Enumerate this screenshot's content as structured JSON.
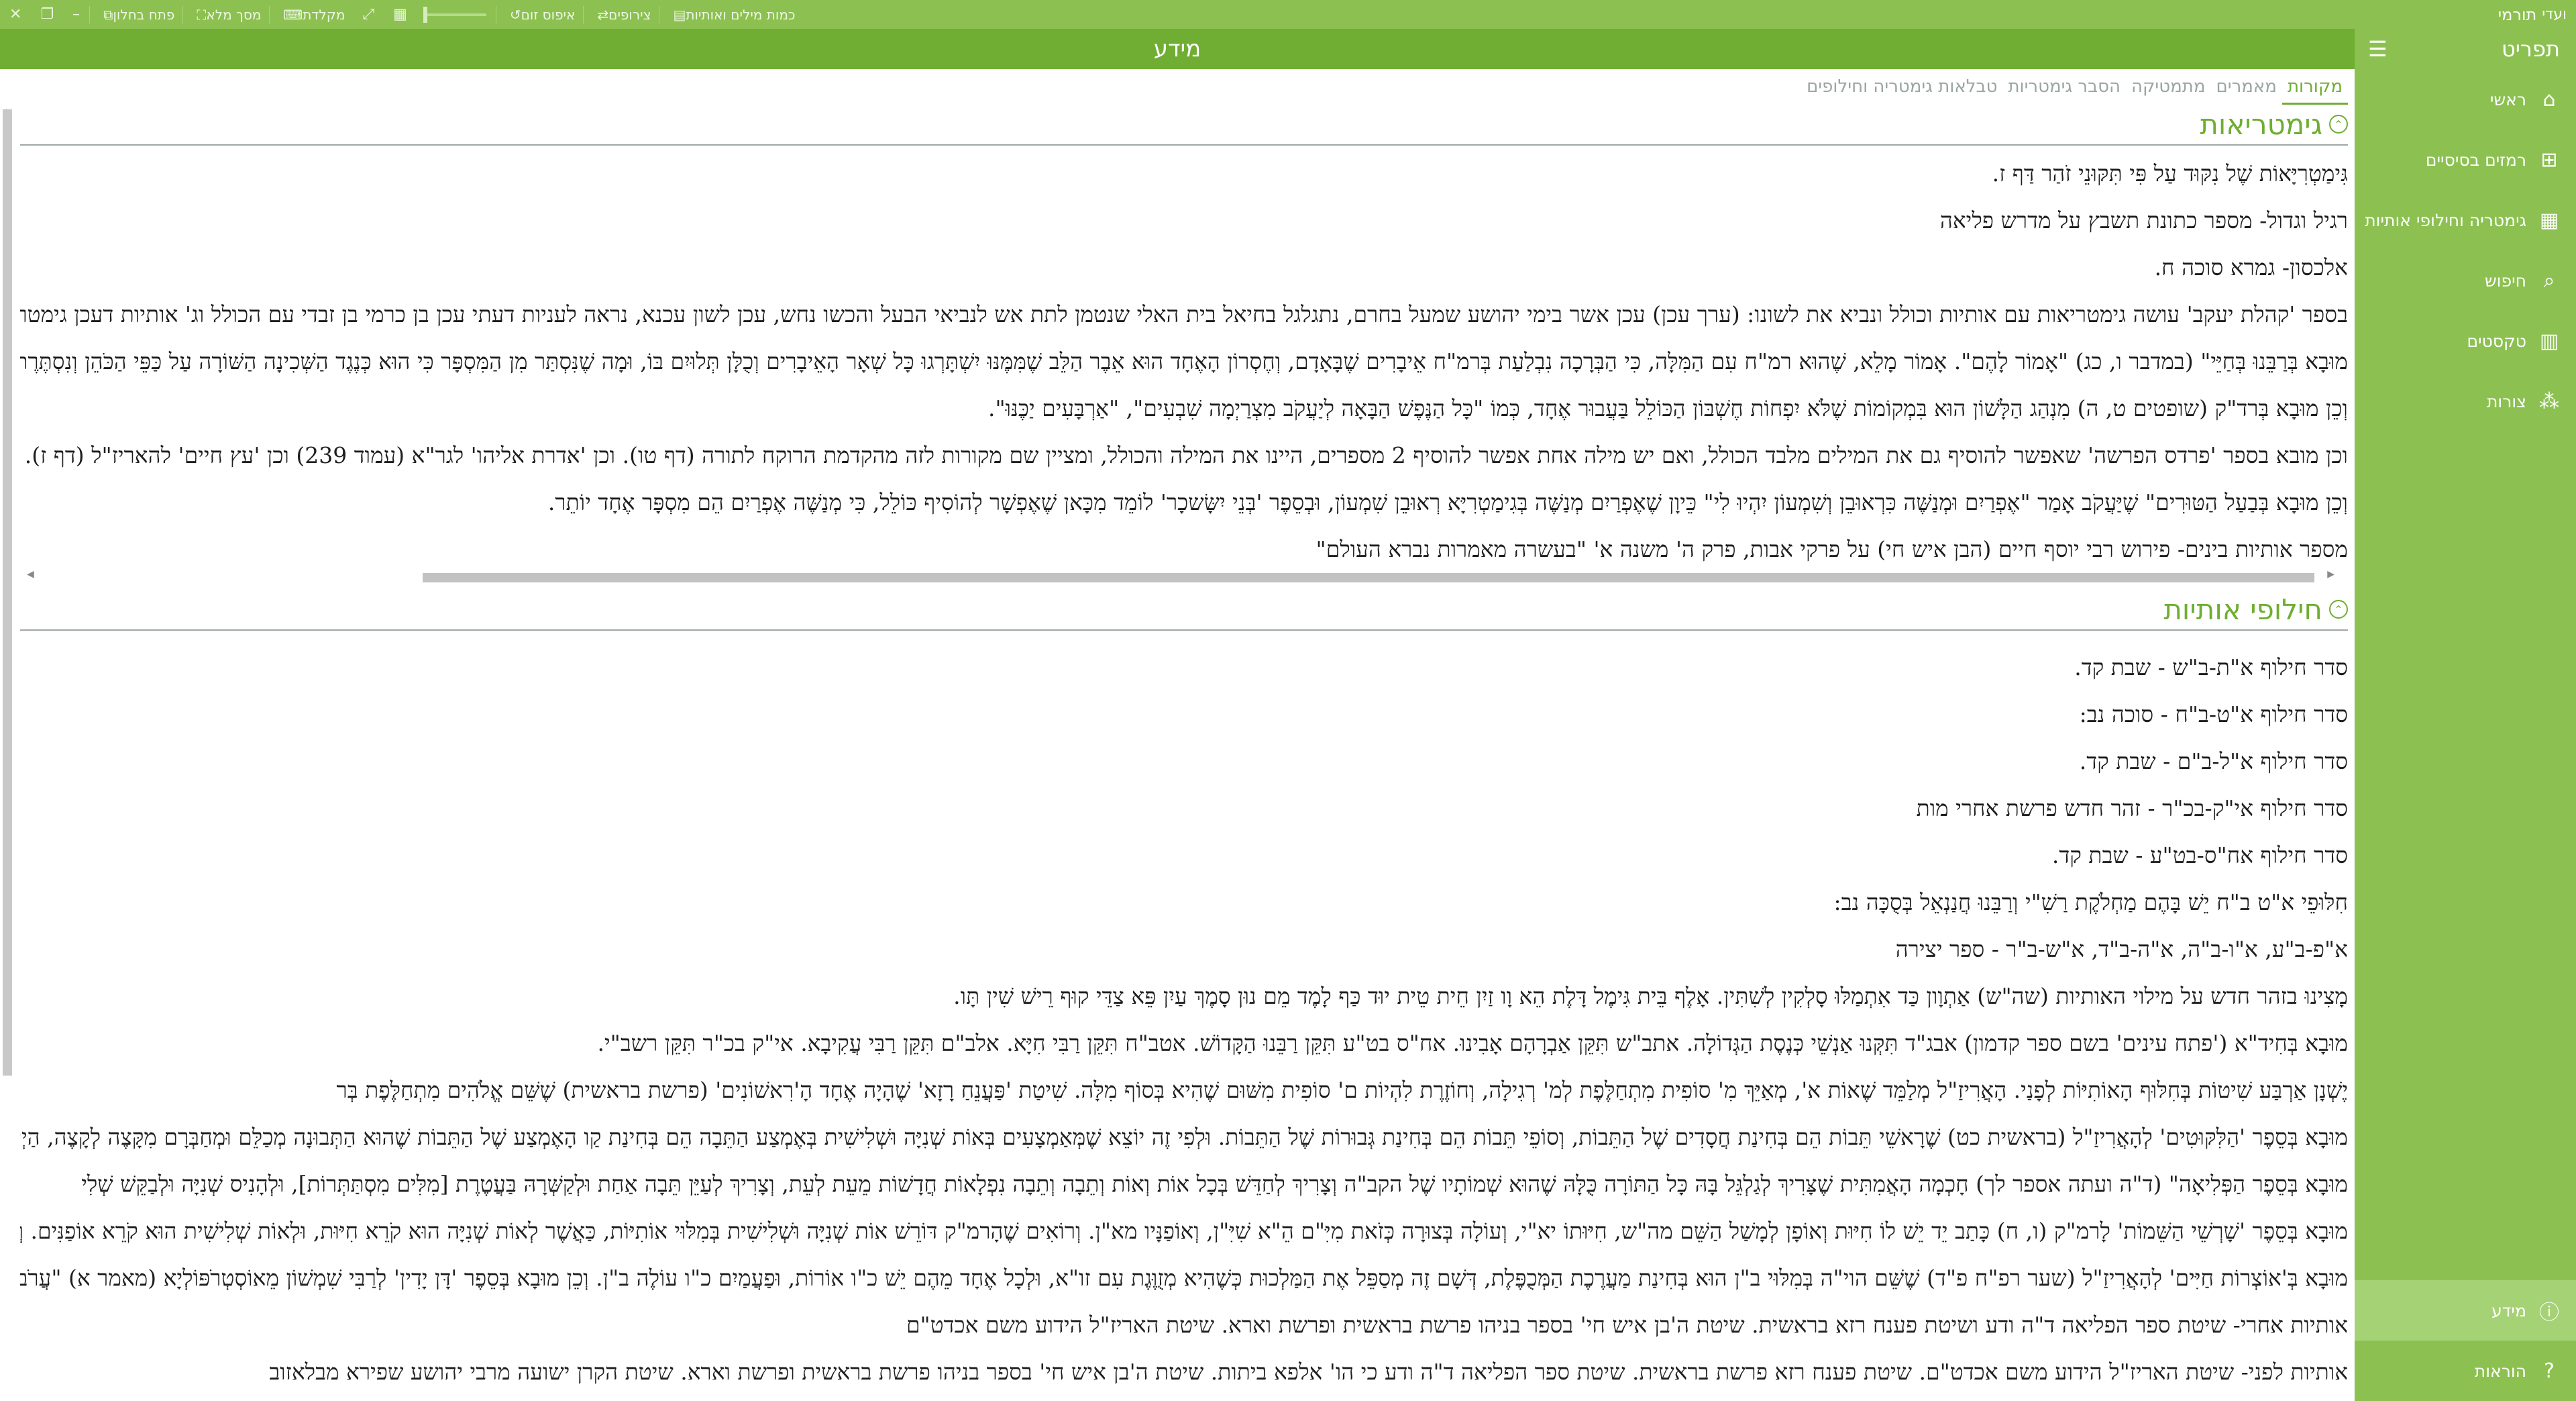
{
  "window": {
    "app_name": "תורמי",
    "logo_text": "ועדי"
  },
  "toolbar": {
    "items": [
      {
        "label": "פתח בחלון",
        "icon": "new-window-icon"
      },
      {
        "label": "מסך מלא",
        "icon": "fullscreen-icon"
      },
      {
        "label": "מקלדת",
        "icon": "keyboard-icon"
      },
      {
        "label": "איפוס זום",
        "icon": "reset-zoom-icon"
      },
      {
        "label": "צירופים",
        "icon": "shuffle-icon"
      },
      {
        "label": "כמות מילים ואותיות",
        "icon": "word-count-icon"
      }
    ]
  },
  "title": "מידע",
  "sidebar": {
    "header": "תפריט",
    "items": [
      {
        "label": "ראשי",
        "icon": "home-icon"
      },
      {
        "label": "רמזים בסיסיים",
        "icon": "grid-icon"
      },
      {
        "label": "גימטריה וחילופי אותיות",
        "icon": "calculator-icon"
      },
      {
        "label": "חיפוש",
        "icon": "search-icon"
      },
      {
        "label": "טקסטים",
        "icon": "book-icon"
      },
      {
        "label": "צורות",
        "icon": "shapes-icon"
      }
    ],
    "bottom": [
      {
        "label": "מידע",
        "icon": "info-icon",
        "active": true
      },
      {
        "label": "הוראות",
        "icon": "help-icon",
        "active": false
      }
    ]
  },
  "tabs": [
    {
      "label": "מקורות",
      "active": true
    },
    {
      "label": "מאמרים",
      "active": false
    },
    {
      "label": "מתמטיקה",
      "active": false
    },
    {
      "label": "הסבר גימטריות",
      "active": false
    },
    {
      "label": "טבלאות גימטריה וחילופים",
      "active": false
    }
  ],
  "sections": {
    "gematria": {
      "title": "גימטריאות",
      "lines": [
        "גִּימַטְרִיָּאוֹת שֶׁל נִקּוּד עַל פִּי תִּקּוּנֵי זֹהַר דַּף ז.",
        "רגיל וגדול- מספר כתונת תשבץ על מדרש פליאה",
        "אלכסון- גמרא סוכה ח.",
        "בספר 'קהלת יעקב' עושה גימטריאות עם אותיות וכולל ונביא את לשונו: (ערך עכן) עכן אשר בימי יהושע שמעל בחרם, נתגלגל בחיאל בית האלי שנטמן לתת אש לנביאי הבעל והכשו נחש, עכן לשון עכנא, נראה לעניות דעתי עכן בן כרמי בן זבדי עם הכולל וג' אותיות דעכן גימטריא זו",
        "מוּבָא בְּרַבֵּנוּ בְּחַיֵּי\" (במדבר ו, כג) \"אָמוֹר לָהֶם\". אָמוֹר מָלֵא, שֶׁהוּא רמ\"ח עִם הַמִּלָּה, כִּי הַבְּרָכָה נִבְלַעַת בְּרמ\"ח אֵיבָרִים שֶׁבָּאָדָם, וְחֶסְרוֹן הָאֶחָד הוּא אֵבֶר הַלֵּב שֶׁמִּמֶּנּוּ יִשְׁתָּרְגוּ כָּל שְׁאָר הָאֵיבָרִים וְכֻלָּן תְּלוּיִם בּוֹ, וּמָה שֶׁנִּסְתַּר מִן הַמִּסְפָּר כִּי הוּא כְּנֶגֶד הַשְּׁכִינָה הַשּׁוֹרָה עַל כַּפֵּי הַכֹּהֵן וְנִסְתֶּרֶת הַ",
        "וְכֵן מוּבָא בְּרד\"ק (שופטים ט, ה) מִנְהַג הַלָּשׁוֹן הוּא בִּמְקוֹמוֹת שֶׁלֹּא יִפְחוֹת חֶשְׁבּוֹן הַכּוֹלֵל בַּעֲבוּר אֶחָד, כְּמוֹ \"כָּל הַנֶּפֶשׁ הַבָּאָה לְיַעֲקֹב מִצְרַיְמָה שִׁבְעִים\", \"אַרְבָּעִים יַכֶּנּוּ\".",
        "וכן מובא בספר 'פרדס הפרשה' שאפשר להוסיף גם את המילים מלבד הכולל, ואם יש מילה אחת אפשר להוסיף 2 מספרים, היינו את המילה והכולל, ומציין שם מקורות לזה מהקדמת הרוקח לתורה (דף טו). וכן 'אדרת אליהו' לגר\"א (עמוד 239) וכן 'עץ חיים' להאריז\"ל (דף ז).",
        "וְכֵן מוּבָא בְּבַעַל הַטּוּרִים\" שֶׁיַּעֲקֹב אָמַר \"אֶפְרַיִם וּמְנַשֶּׁה כִּרְאוּבֵן וְשִׁמְעוֹן יִהְיוּ לִי\" כֵּיוָן שֶׁאֶפְרַיִם מְנַשֶּׁה בְּגִימַטְרִיָּא רְאוּבֵן שִׁמְעוֹן, וּבְסֵפֶר 'בְּנֵי יִשָּׂשכָר' לוֹמֵד מִכָּאן שֶׁאֶפְשָׁר לְהוֹסִיף כּוֹלֵל, כִּי מְנַשֶּׁה אֶפְרַיִם הֵם מִסְפָּר אֶחָד יוֹתֵר.",
        "מספר אותיות בינים- פירוש רבי יוסף חיים (הבן איש חי) על פרקי אבות, פרק ה' משנה א' \"בעשרה מאמרות נברא העולם\""
      ]
    },
    "letters": {
      "title": "חילופי אותיות",
      "lines": [
        "סדר חילוף א\"ת-ב\"ש - שבת קד.",
        "סדר חילוף א\"ט-ב\"ח - סוכה נב:",
        "סדר חילוף א\"ל-ב\"ם - שבת קד.",
        "סדר חילוף אי\"ק-בכ\"ר - זהר חדש פרשת אחרי מות",
        "סדר חילוף אח\"ס-בט\"ע - שבת קד.",
        "חִלּוּפֵי א\"ט ב\"ח יֵשׁ בָּהֶם מַחְלֹקֶת רַשִׁ\"י וְרַבֵּנוּ חֲנַנְאֵל בְּסֻכָּה נב:",
        "א\"פ-ב\"ע, א\"ו-ב\"ה, א\"ה-ב\"ד, א\"ש-ב\"ר - ספר יצירה",
        "מָצִינוּ בזהר חדש על מילוי האותיות (שה\"ש) אַתְוָון כַּד אִתְמַלּוּ סָלְקִין לְשִׁתִּין. אָלֶף בֵּית גִּימֶל דָּלֶת הֵא וָו זַיִן חֵית טֵית יוּד כַּף לָמֶד מֵם נוּן סָמֶךְ עַיִן פֵּא צַדֵּי קוּף רֵישׁ שִׁין תָּו.",
        "מוּבָא בְּחִיד\"א ('פתח עינים' בשם ספר קדמון) אבג\"ד תִּקְּנוּ אַנְשֵׁי כְּנֶסֶת הַגְּדוֹלָה. אתב\"ש תִּקֵּן אַבְרָהָם אָבִינוּ. אח\"ס בט\"ע תִּקֵּן רַבֵּנוּ הַקָּדוֹשׁ. אטב\"ח תִּקֵּן רַבִּי חִיָּא. אלב\"ם תִּקֵּן רַבִּי עֲקִיבָא. אי\"ק בכ\"ר תִּקֵּן רשב\"י.",
        "יֶשְׁנָן אַרְבַּע שִׁיטוֹת בְּחִלּוּף הָאוֹתִיּוֹת לְפָנַי. הָאֲרִיזַ\"ל מְלַמֵּד שֶׁאוֹת א', מְאַיֵּךְ מִ' סוֹפִית מִתְחַלֶּפֶת לְמ' רְגִילָה, וְחוֹזֶרֶת לִהְיוֹת ם' סוֹפִית מִשּׁוּם שֶׁהִיא בְּסוֹף מִלָּה. שִׁיטַת 'פַּעֲנֵחַ רָזָא' שֶׁהָיָה אֶחָד הָ'רִאשׁוֹנִים' (פרשת בראשית) שֶׁשֵּׁם אֱלֹהִים מִתְחַלֶּפֶת בְּר",
        "מוּבָא בְּסֵפֶר 'הַלִּקּוּטִים' לְהָאֲרִיזַ\"ל (בראשית כט) שֶׁרָאשֵׁי תֵּבוֹת הֵם בְּחִינַת חֲסָדִים שֶׁל הַתֵּבוֹת, וְסוֹפֵי תֵּבוֹת הֵם בְּחִינַת גְּבוּרוֹת שֶׁל הַתֵּבוֹת. וּלְפִי זֶה יוֹצֵא שֶׁמְּאַמְצָעִים בְּאוֹת שְׁנִיָּה וּשְׁלִישִׁית בְּאֶמְצַע הַתֵּבָה הֵם בְּחִינַת קַו הָאֶמְצַע שֶׁל הַתֵּבוֹת שֶׁהוּא הַתְּבוּנָה מְכַלֵּם וּמְחַבְּרָם מִקָּצֶה לְקָצֶה, הַיְינוּ",
        "מוּבָא בְּסֵפֶר הַפְּלִיאָה\" (ד\"ה ועתה אספר לך) חָכְמָה הָאֲמִתִּית שֶׁצָּרִיךְ לְגַלְגֵּל בָּהּ כָּל הַתּוֹרָה כֻּלָּהּ שֶׁהוּא שְׁמוֹתָיו שֶׁל הקב\"ה וְצָרִיךְ לְחַדֵּשׁ בְּכָל אוֹת וְאוֹת וְתֵבָה וְתֵבָה נִפְלָאוֹת חֲדָשׁוֹת מֵעֵת לְעֵת, וְצָרִיךְ לְעַיֵּן תֵּבָה אַחַת וּלְקַשְּׁרָהּ בַּעֲטֶרֶת [מִלִּים מִסְתַּתְּרוֹת], וּלְהָנִיס שְׁנִיָּה וּלְבַקֵּשׁ שְׁלִי",
        "מוּבָא בְּסֵפֶר 'שָׁרְשֵׁי הַשֵּׁמוֹת' לָרמ\"ק (ו, ח) כָּתַב יֵד יֵשׁ לוֹ חִיּוּת וְאוֹפָן לְמָשַׁל הַשֵּׁם מה\"ש, חִיּוּתוֹ יא\"י, וְעוֹלָה בְּצוּרָה כְּזֹאת מִיִּ\"ם הֵ\"א שִׁיִּ\"ן, וְאוֹפַנָּיו מא\"ן. וְרוֹאִים שֶׁהָרמ\"ק דּוֹרֵשׁ אוֹת שְׁנִיָּה וּשְׁלִישִׁית בְּמִלּוּי אוֹתִיּוֹת, כַּאֲשֶׁר לְאוֹת שְׁנִיָּה הוּא קֹרֵא חִיּוּת, וּלְאוֹת שְׁלִישִׁית הוּא קֹרֵא אוֹפַנִּים. וְכֵן רוֹאִי",
        "מוּבָא בְּ'אוֹצְרוֹת חַיִּים' לְהָאֲרִיזַ\"ל (שער רפ\"ח פ\"ד) שֶׁשֵּׁם הוי\"ה בְּמִלּוּי ב\"ן הוּא בְּחִינַת מַעֲרֶכֶת הַמְּכֻפֶּלֶת, דְּשָׁם זֶה מְסַפֵּל אֶת הַמַּלְכוּת כְּשֶׁהִיא מְזֻוֶּגֶת עִם זו\"א, וּלְכָל אֶחָד מֵהֶם יֵשׁ כ\"ו אוֹרוֹת, וּפַעֲמַיִם כ\"ו עוֹלֶה ב\"ן. וְכֵן מוּבָא בְּסֵפֶר 'דָּן יָדִין' לְרַבִּי שִׁמְשׁוֹן מֵאוֹסְטְרֹפּוֹלְיָא (מאמר א) \"עֲרֹב עַבְדְּךָ לְ",
        "אותיות אחרי- שיטת ספר הפליאה ד\"ה ודע ושיטת פענח רזא בראשית. שיטת ה'בן איש חי' בספר בניהו פרשת בראשית ופרשת וארא. שיטת האריז\"ל הידוע משם אכדט\"ם",
        "אותיות לפני- שיטת האריז\"ל הידוע משם אכדט\"ם. שיטת פענח רזא פרשת בראשית. שיטת ספר הפליאה ד\"ה ודע כי הו' אלפא ביתות. שיטת ה'בן איש חי' בספר בניהו פרשת בראשית ופרשת וארא. שיטת הקרן ישועה מרבי יהושע שפירא מבלאזוב"
      ]
    }
  },
  "colors": {
    "accent": "#6fae32",
    "toolbar": "#8cc152",
    "sidebar": "#8cc152"
  }
}
